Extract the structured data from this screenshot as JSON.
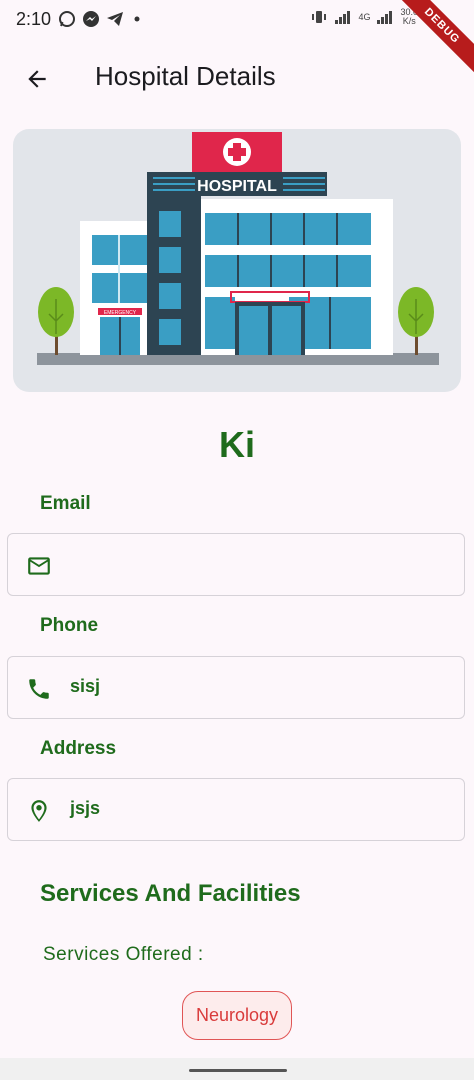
{
  "status_bar": {
    "time": "2:10",
    "network_speed": "30.0",
    "network_unit": "K/s",
    "network_type": "4G",
    "icons": [
      "whatsapp-icon",
      "messenger-icon",
      "telegram-icon",
      "dot-icon",
      "vibrate-icon",
      "signal-icon",
      "signal-icon"
    ]
  },
  "debug_banner": "DEBUG",
  "app_bar": {
    "title": "Hospital Details",
    "back_icon": "arrow-back-icon"
  },
  "hero": {
    "sign_text": "HOSPITAL",
    "emergency_text": "EMERGENCY",
    "image_icon": "hospital-illustration"
  },
  "hospital": {
    "name": "Ki"
  },
  "fields": {
    "email": {
      "label": "Email",
      "value": "",
      "icon": "mail-icon"
    },
    "phone": {
      "label": "Phone",
      "value": "sisj",
      "icon": "phone-icon"
    },
    "address": {
      "label": "Address",
      "value": "jsjs",
      "icon": "location-pin-icon"
    }
  },
  "services": {
    "title": "Services And Facilities",
    "offered_label": "Services Offered :",
    "items": [
      "Neurology"
    ]
  },
  "colors": {
    "accent_green": "#1f6b1c",
    "chip_red": "#d93b3b",
    "background": "#fdf7fb"
  }
}
